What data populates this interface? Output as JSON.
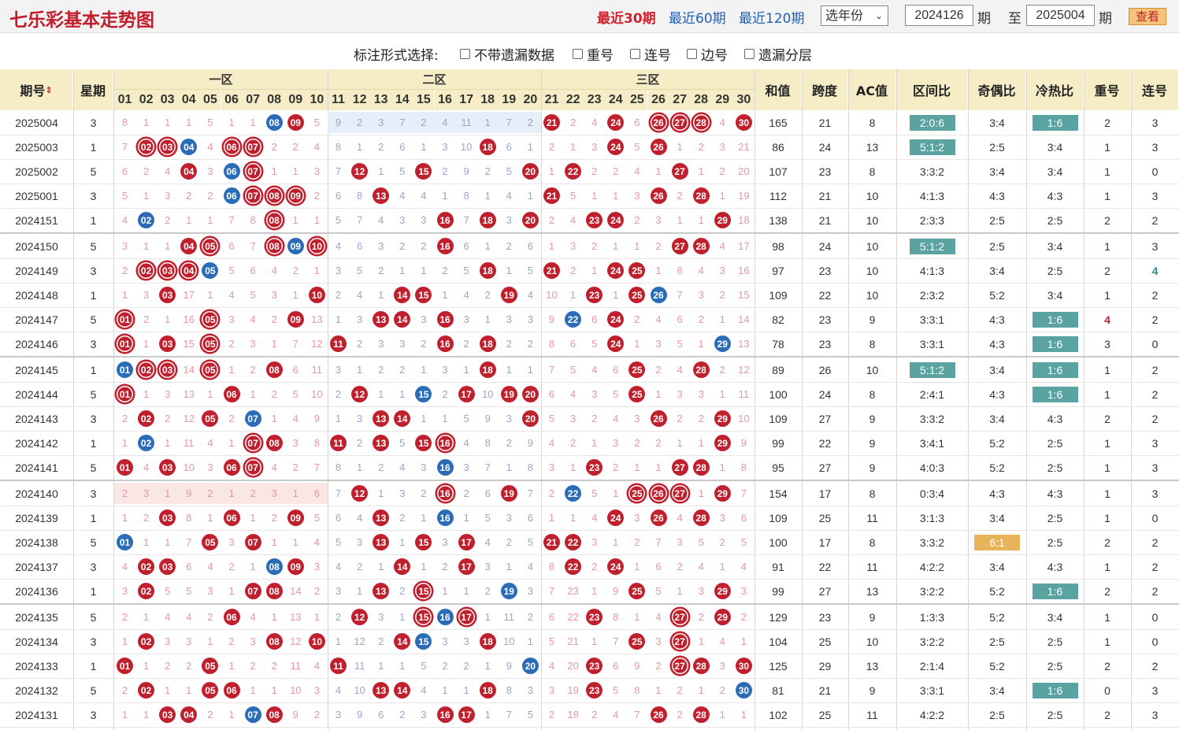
{
  "title": "七乐彩基本走势图",
  "periods": {
    "p30": "最近30期",
    "p60": "最近60期",
    "p120": "最近120期"
  },
  "year_select": "选年份",
  "from_value": "2024126",
  "to_value": "2025004",
  "qi_label": "期",
  "zhi_label": "至",
  "query_button": "查看",
  "options": {
    "label": "标注形式选择:",
    "items": [
      "不带遗漏数据",
      "重号",
      "连号",
      "边号",
      "遗漏分层"
    ]
  },
  "headers": {
    "issue": "期号",
    "sort_icon": "sort-icon",
    "week": "星期",
    "zones": [
      "一区",
      "二区",
      "三区"
    ],
    "stats": [
      "和值",
      "跨度",
      "AC值",
      "区间比",
      "奇偶比",
      "冷热比",
      "重号",
      "连号"
    ]
  },
  "numbers": [
    "01",
    "02",
    "03",
    "04",
    "05",
    "06",
    "07",
    "08",
    "09",
    "10",
    "11",
    "12",
    "13",
    "14",
    "15",
    "16",
    "17",
    "18",
    "19",
    "20",
    "21",
    "22",
    "23",
    "24",
    "25",
    "26",
    "27",
    "28",
    "29",
    "30"
  ],
  "colors": {
    "red": "#c0202d",
    "blue": "#2b6cb8",
    "teal": "#5aa3a0",
    "orange": "#e8b45a",
    "header_bg": "#f6ecc6"
  },
  "rows": [
    {
      "issue": "2025004",
      "week": "3",
      "cells": [
        "8",
        "1",
        "1",
        "1",
        "5",
        "1",
        "1",
        "B08",
        "R09",
        "5",
        "9",
        "2",
        "3",
        "7",
        "2",
        "4",
        "11",
        "1",
        "7",
        "2",
        "R21",
        "2",
        "4",
        "R24",
        "6",
        "RR26",
        "RR27",
        "RR28",
        "4",
        "R30"
      ],
      "sum": "165",
      "span": "21",
      "ac": "8",
      "zone": "2:0:6",
      "zt": "teal",
      "oe": "3:4",
      "oet": "",
      "hc": "1:6",
      "hct": "teal",
      "rep": "2",
      "conn": "3"
    },
    {
      "issue": "2025003",
      "week": "1",
      "cells": [
        "7",
        "RR02",
        "RR03",
        "B04",
        "4",
        "RR06",
        "RR07",
        "2",
        "2",
        "4",
        "8",
        "1",
        "2",
        "6",
        "1",
        "3",
        "10",
        "R18",
        "6",
        "1",
        "2",
        "1",
        "3",
        "R24",
        "5",
        "R26",
        "1",
        "2",
        "3",
        "21"
      ],
      "sum": "86",
      "span": "24",
      "ac": "13",
      "zone": "5:1:2",
      "zt": "teal",
      "oe": "2:5",
      "oet": "",
      "hc": "3:4",
      "hct": "",
      "rep": "1",
      "conn": "3"
    },
    {
      "issue": "2025002",
      "week": "5",
      "cells": [
        "6",
        "2",
        "4",
        "R04",
        "3",
        "B06",
        "RR07",
        "1",
        "1",
        "3",
        "7",
        "R12",
        "1",
        "5",
        "R15",
        "2",
        "9",
        "2",
        "5",
        "R20",
        "1",
        "R22",
        "2",
        "2",
        "4",
        "1",
        "R27",
        "1",
        "2",
        "20"
      ],
      "sum": "107",
      "span": "23",
      "ac": "8",
      "zone": "3:3:2",
      "zt": "",
      "oe": "3:4",
      "oet": "",
      "hc": "3:4",
      "hct": "",
      "rep": "1",
      "conn": "0"
    },
    {
      "issue": "2025001",
      "week": "3",
      "cells": [
        "5",
        "1",
        "3",
        "2",
        "2",
        "B06",
        "RR07",
        "RR08",
        "RR09",
        "2",
        "6",
        "8",
        "R13",
        "4",
        "4",
        "1",
        "8",
        "1",
        "4",
        "1",
        "R21",
        "5",
        "1",
        "1",
        "3",
        "R26",
        "2",
        "R28",
        "1",
        "19"
      ],
      "sum": "112",
      "span": "21",
      "ac": "10",
      "zone": "4:1:3",
      "zt": "",
      "oe": "4:3",
      "oet": "",
      "hc": "4:3",
      "hct": "",
      "rep": "1",
      "conn": "3"
    },
    {
      "issue": "2024151",
      "week": "1",
      "cells": [
        "4",
        "B02",
        "2",
        "1",
        "1",
        "7",
        "8",
        "RR08",
        "1",
        "1",
        "5",
        "7",
        "4",
        "3",
        "3",
        "R16",
        "7",
        "R18",
        "3",
        "R20",
        "2",
        "4",
        "R23",
        "R24",
        "2",
        "3",
        "1",
        "1",
        "R29",
        "18"
      ],
      "sum": "138",
      "span": "21",
      "ac": "10",
      "zone": "2:3:3",
      "zt": "",
      "oe": "2:5",
      "oet": "",
      "hc": "2:5",
      "hct": "",
      "rep": "2",
      "conn": "2"
    },
    {
      "issue": "2024150",
      "week": "5",
      "cells": [
        "3",
        "1",
        "1",
        "R04",
        "RR05",
        "6",
        "7",
        "RR08",
        "B09",
        "RR10",
        "4",
        "6",
        "3",
        "2",
        "2",
        "R16",
        "6",
        "1",
        "2",
        "6",
        "1",
        "3",
        "2",
        "1",
        "1",
        "2",
        "R27",
        "R28",
        "4",
        "17"
      ],
      "sum": "98",
      "span": "24",
      "ac": "10",
      "zone": "5:1:2",
      "zt": "teal",
      "oe": "2:5",
      "oet": "",
      "hc": "3:4",
      "hct": "",
      "rep": "1",
      "conn": "3"
    },
    {
      "issue": "2024149",
      "week": "3",
      "cells": [
        "2",
        "RR02",
        "RR03",
        "RR04",
        "B05",
        "5",
        "6",
        "4",
        "2",
        "1",
        "3",
        "5",
        "2",
        "1",
        "1",
        "2",
        "5",
        "R18",
        "1",
        "5",
        "R21",
        "2",
        "1",
        "R24",
        "R25",
        "1",
        "8",
        "4",
        "3",
        "16"
      ],
      "sum": "97",
      "span": "23",
      "ac": "10",
      "zone": "4:1:3",
      "zt": "",
      "oe": "3:4",
      "oet": "",
      "hc": "2:5",
      "hct": "",
      "rep": "2",
      "conn": "4",
      "conncolor": "teal"
    },
    {
      "issue": "2024148",
      "week": "1",
      "cells": [
        "1",
        "3",
        "R03",
        "17",
        "1",
        "4",
        "5",
        "3",
        "1",
        "R10",
        "2",
        "4",
        "1",
        "R14",
        "R15",
        "1",
        "4",
        "2",
        "R19",
        "4",
        "10",
        "1",
        "R23",
        "1",
        "R25",
        "B26",
        "7",
        "3",
        "2",
        "15"
      ],
      "sum": "109",
      "span": "22",
      "ac": "10",
      "zone": "2:3:2",
      "zt": "",
      "oe": "5:2",
      "oet": "",
      "hc": "3:4",
      "hct": "",
      "rep": "1",
      "conn": "2"
    },
    {
      "issue": "2024147",
      "week": "5",
      "cells": [
        "RR01",
        "2",
        "1",
        "16",
        "RR05",
        "3",
        "4",
        "2",
        "R09",
        "13",
        "1",
        "3",
        "R13",
        "R14",
        "3",
        "R16",
        "3",
        "1",
        "3",
        "3",
        "9",
        "B22",
        "6",
        "R24",
        "2",
        "4",
        "6",
        "2",
        "1",
        "14"
      ],
      "sum": "82",
      "span": "23",
      "ac": "9",
      "zone": "3:3:1",
      "zt": "",
      "oe": "4:3",
      "oet": "",
      "hc": "1:6",
      "hct": "teal",
      "rep": "4",
      "repcolor": "red",
      "conn": "2"
    },
    {
      "issue": "2024146",
      "week": "3",
      "cells": [
        "RR01",
        "1",
        "R03",
        "15",
        "RR05",
        "2",
        "3",
        "1",
        "7",
        "12",
        "R11",
        "2",
        "3",
        "3",
        "2",
        "R16",
        "2",
        "R18",
        "2",
        "2",
        "8",
        "6",
        "5",
        "R24",
        "1",
        "3",
        "5",
        "1",
        "B29",
        "13"
      ],
      "sum": "78",
      "span": "23",
      "ac": "8",
      "zone": "3:3:1",
      "zt": "",
      "oe": "4:3",
      "oet": "",
      "hc": "1:6",
      "hct": "teal",
      "rep": "3",
      "conn": "0"
    },
    {
      "issue": "2024145",
      "week": "1",
      "cells": [
        "B01",
        "RR02",
        "RR03",
        "14",
        "RR05",
        "1",
        "2",
        "R08",
        "6",
        "11",
        "3",
        "1",
        "2",
        "2",
        "1",
        "3",
        "1",
        "R18",
        "1",
        "1",
        "7",
        "5",
        "4",
        "6",
        "R25",
        "2",
        "4",
        "R28",
        "2",
        "12"
      ],
      "sum": "89",
      "span": "26",
      "ac": "10",
      "zone": "5:1:2",
      "zt": "teal",
      "oe": "3:4",
      "oet": "",
      "hc": "1:6",
      "hct": "teal",
      "rep": "1",
      "conn": "2"
    },
    {
      "issue": "2024144",
      "week": "5",
      "cells": [
        "RR01",
        "1",
        "3",
        "13",
        "1",
        "R06",
        "1",
        "2",
        "5",
        "10",
        "2",
        "R12",
        "1",
        "1",
        "B15",
        "2",
        "R17",
        "10",
        "R19",
        "R20",
        "6",
        "4",
        "3",
        "5",
        "R25",
        "1",
        "3",
        "3",
        "1",
        "11"
      ],
      "sum": "100",
      "span": "24",
      "ac": "8",
      "zone": "2:4:1",
      "zt": "",
      "oe": "4:3",
      "oet": "",
      "hc": "1:6",
      "hct": "teal",
      "rep": "1",
      "conn": "2"
    },
    {
      "issue": "2024143",
      "week": "3",
      "cells": [
        "2",
        "R02",
        "2",
        "12",
        "R05",
        "2",
        "B07",
        "1",
        "4",
        "9",
        "1",
        "3",
        "R13",
        "R14",
        "1",
        "1",
        "5",
        "9",
        "3",
        "R20",
        "5",
        "3",
        "2",
        "4",
        "3",
        "R26",
        "2",
        "2",
        "R29",
        "10"
      ],
      "sum": "109",
      "span": "27",
      "ac": "9",
      "zone": "3:3:2",
      "zt": "",
      "oe": "3:4",
      "oet": "",
      "hc": "4:3",
      "hct": "",
      "rep": "2",
      "conn": "2"
    },
    {
      "issue": "2024142",
      "week": "1",
      "cells": [
        "1",
        "B02",
        "1",
        "11",
        "4",
        "1",
        "RR07",
        "R08",
        "3",
        "8",
        "R11",
        "2",
        "R13",
        "5",
        "R15",
        "RR16",
        "4",
        "8",
        "2",
        "9",
        "4",
        "2",
        "1",
        "3",
        "2",
        "2",
        "1",
        "1",
        "R29",
        "9"
      ],
      "sum": "99",
      "span": "22",
      "ac": "9",
      "zone": "3:4:1",
      "zt": "",
      "oe": "5:2",
      "oet": "",
      "hc": "2:5",
      "hct": "",
      "rep": "1",
      "conn": "3"
    },
    {
      "issue": "2024141",
      "week": "5",
      "cells": [
        "R01",
        "4",
        "R03",
        "10",
        "3",
        "R06",
        "RR07",
        "4",
        "2",
        "7",
        "8",
        "1",
        "2",
        "4",
        "3",
        "B16",
        "3",
        "7",
        "1",
        "8",
        "3",
        "1",
        "R23",
        "2",
        "1",
        "1",
        "R27",
        "R28",
        "1",
        "8"
      ],
      "sum": "95",
      "span": "27",
      "ac": "9",
      "zone": "4:0:3",
      "zt": "",
      "oe": "5:2",
      "oet": "",
      "hc": "2:5",
      "hct": "",
      "rep": "1",
      "conn": "3"
    },
    {
      "issue": "2024140",
      "week": "3",
      "cells": [
        "2",
        "3",
        "1",
        "9",
        "2",
        "1",
        "2",
        "3",
        "1",
        "6",
        "7",
        "R12",
        "1",
        "3",
        "2",
        "RR16",
        "2",
        "6",
        "R19",
        "7",
        "2",
        "B22",
        "5",
        "1",
        "RR25",
        "RR26",
        "RR27",
        "1",
        "R29",
        "7"
      ],
      "sum": "154",
      "span": "17",
      "ac": "8",
      "zone": "0:3:4",
      "zt": "",
      "oe": "4:3",
      "oet": "",
      "hc": "4:3",
      "hct": "",
      "rep": "1",
      "conn": "3",
      "pinkzone1": true
    },
    {
      "issue": "2024139",
      "week": "1",
      "cells": [
        "1",
        "2",
        "R03",
        "8",
        "1",
        "R06",
        "1",
        "2",
        "R09",
        "5",
        "6",
        "4",
        "R13",
        "2",
        "1",
        "B16",
        "1",
        "5",
        "3",
        "6",
        "1",
        "1",
        "4",
        "R24",
        "3",
        "R26",
        "4",
        "R28",
        "3",
        "6"
      ],
      "sum": "109",
      "span": "25",
      "ac": "11",
      "zone": "3:1:3",
      "zt": "",
      "oe": "3:4",
      "oet": "",
      "hc": "2:5",
      "hct": "",
      "rep": "1",
      "conn": "0"
    },
    {
      "issue": "2024138",
      "week": "5",
      "cells": [
        "B01",
        "1",
        "1",
        "7",
        "R05",
        "3",
        "R07",
        "1",
        "1",
        "4",
        "5",
        "3",
        "R13",
        "1",
        "R15",
        "3",
        "R17",
        "4",
        "2",
        "5",
        "R21",
        "R22",
        "3",
        "1",
        "2",
        "7",
        "3",
        "5",
        "2",
        "5"
      ],
      "sum": "100",
      "span": "17",
      "ac": "8",
      "zone": "3:3:2",
      "zt": "",
      "oe": "6:1",
      "oet": "orange",
      "hc": "2:5",
      "hct": "",
      "rep": "2",
      "conn": "2"
    },
    {
      "issue": "2024137",
      "week": "3",
      "cells": [
        "4",
        "R02",
        "R03",
        "6",
        "4",
        "2",
        "1",
        "B08",
        "R09",
        "3",
        "4",
        "2",
        "1",
        "R14",
        "1",
        "2",
        "R17",
        "3",
        "1",
        "4",
        "8",
        "R22",
        "2",
        "R24",
        "1",
        "6",
        "2",
        "4",
        "1",
        "4"
      ],
      "sum": "91",
      "span": "22",
      "ac": "11",
      "zone": "4:2:2",
      "zt": "",
      "oe": "3:4",
      "oet": "",
      "hc": "4:3",
      "hct": "",
      "rep": "1",
      "conn": "2"
    },
    {
      "issue": "2024136",
      "week": "1",
      "cells": [
        "3",
        "R02",
        "5",
        "5",
        "3",
        "1",
        "R07",
        "R08",
        "14",
        "2",
        "3",
        "1",
        "R13",
        "2",
        "RR15",
        "1",
        "1",
        "2",
        "B19",
        "3",
        "7",
        "23",
        "1",
        "9",
        "R25",
        "5",
        "1",
        "3",
        "R29",
        "3"
      ],
      "sum": "99",
      "span": "27",
      "ac": "13",
      "zone": "3:2:2",
      "zt": "",
      "oe": "5:2",
      "oet": "",
      "hc": "1:6",
      "hct": "teal",
      "rep": "2",
      "conn": "2"
    },
    {
      "issue": "2024135",
      "week": "5",
      "cells": [
        "2",
        "1",
        "4",
        "4",
        "2",
        "R06",
        "4",
        "1",
        "13",
        "1",
        "2",
        "R12",
        "3",
        "1",
        "RR15",
        "B16",
        "RR17",
        "1",
        "11",
        "2",
        "6",
        "22",
        "R23",
        "8",
        "1",
        "4",
        "RR27",
        "2",
        "R29",
        "2"
      ],
      "sum": "129",
      "span": "23",
      "ac": "9",
      "zone": "1:3:3",
      "zt": "",
      "oe": "5:2",
      "oet": "",
      "hc": "3:4",
      "hct": "",
      "rep": "1",
      "conn": "0"
    },
    {
      "issue": "2024134",
      "week": "3",
      "cells": [
        "1",
        "R02",
        "3",
        "3",
        "1",
        "2",
        "3",
        "R08",
        "12",
        "R10",
        "1",
        "12",
        "2",
        "R14",
        "B15",
        "3",
        "3",
        "R18",
        "10",
        "1",
        "5",
        "21",
        "1",
        "7",
        "R25",
        "3",
        "RR27",
        "1",
        "4",
        "1"
      ],
      "sum": "104",
      "span": "25",
      "ac": "10",
      "zone": "3:2:2",
      "zt": "",
      "oe": "2:5",
      "oet": "",
      "hc": "2:5",
      "hct": "",
      "rep": "1",
      "conn": "0"
    },
    {
      "issue": "2024133",
      "week": "1",
      "cells": [
        "R01",
        "1",
        "2",
        "2",
        "R05",
        "1",
        "2",
        "2",
        "11",
        "4",
        "R11",
        "11",
        "1",
        "1",
        "5",
        "2",
        "2",
        "1",
        "9",
        "B20",
        "4",
        "20",
        "R23",
        "6",
        "9",
        "2",
        "RR27",
        "R28",
        "3",
        "R30"
      ],
      "sum": "125",
      "span": "29",
      "ac": "13",
      "zone": "2:1:4",
      "zt": "",
      "oe": "5:2",
      "oet": "",
      "hc": "2:5",
      "hct": "",
      "rep": "2",
      "conn": "2"
    },
    {
      "issue": "2024132",
      "week": "5",
      "cells": [
        "2",
        "R02",
        "1",
        "1",
        "R05",
        "R06",
        "1",
        "1",
        "10",
        "3",
        "4",
        "10",
        "R13",
        "R14",
        "4",
        "1",
        "1",
        "R18",
        "8",
        "3",
        "3",
        "19",
        "R23",
        "5",
        "8",
        "1",
        "2",
        "1",
        "2",
        "B30"
      ],
      "sum": "81",
      "span": "21",
      "ac": "9",
      "zone": "3:3:1",
      "zt": "",
      "oe": "3:4",
      "oet": "",
      "hc": "1:6",
      "hct": "teal",
      "rep": "0",
      "conn": "3"
    },
    {
      "issue": "2024131",
      "week": "3",
      "cells": [
        "1",
        "1",
        "R03",
        "R04",
        "2",
        "1",
        "B07",
        "R08",
        "9",
        "2",
        "3",
        "9",
        "6",
        "2",
        "3",
        "R16",
        "R17",
        "1",
        "7",
        "5",
        "2",
        "18",
        "2",
        "4",
        "7",
        "R26",
        "2",
        "R28",
        "1",
        "1"
      ],
      "sum": "102",
      "span": "25",
      "ac": "11",
      "zone": "4:2:2",
      "zt": "",
      "oe": "2:5",
      "oet": "",
      "hc": "2:5",
      "hct": "",
      "rep": "2",
      "conn": "3"
    }
  ]
}
